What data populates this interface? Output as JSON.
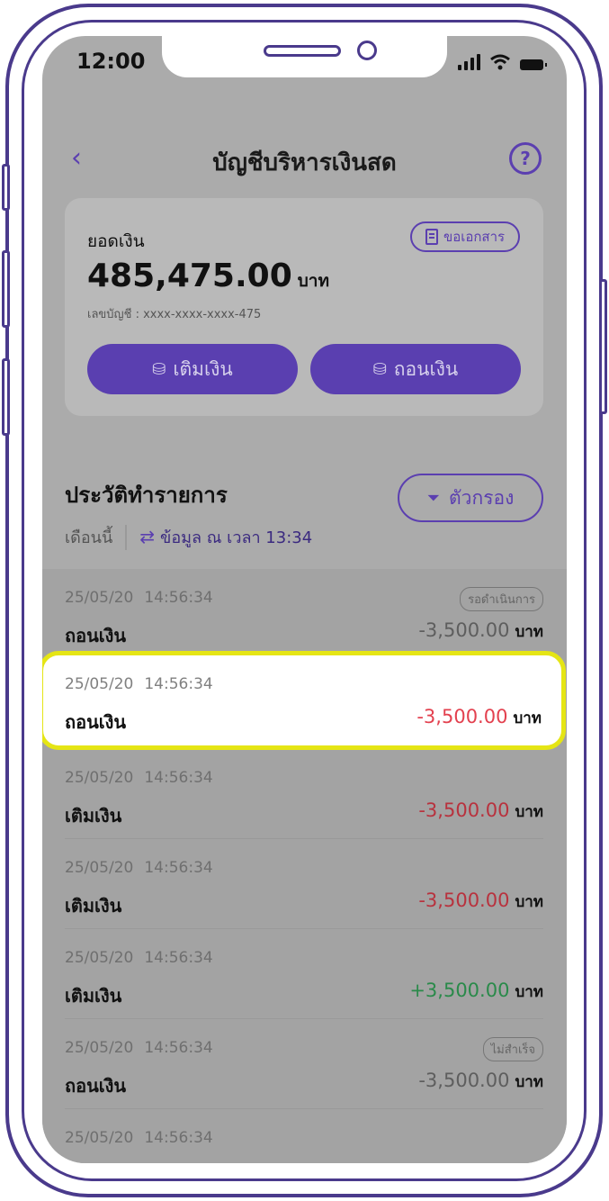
{
  "status_bar": {
    "time": "12:00"
  },
  "header": {
    "back_icon": "‹",
    "title": "บัญชีบริหารเงินสด",
    "help_icon": "?"
  },
  "balance_card": {
    "label": "ยอดเงิน",
    "doc_button": "ขอเอกสาร",
    "amount": "485,475.00",
    "unit": "บาท",
    "account": "เลขบัญชี : xxxx-xxxx-xxxx-475",
    "deposit_button": "เติมเงิน",
    "withdraw_button": "ถอนเงิน"
  },
  "history": {
    "title": "ประวัติทำรายการ",
    "filter_button": "ตัวกรอง",
    "period": "เดือนนี้",
    "sync": "ข้อมูล ณ เวลา 13:34"
  },
  "transactions": [
    {
      "date": "25/05/20",
      "time": "14:56:34",
      "type": "ถอนเงิน",
      "amount": "-3,500.00",
      "unit": "บาท",
      "badge": "รอดำเนินการ",
      "color": "gray"
    },
    {
      "date": "25/05/20",
      "time": "14:56:34",
      "type": "ถอนเงิน",
      "amount": "-3,500.00",
      "unit": "บาท",
      "badge": "",
      "color": "red",
      "highlighted": true
    },
    {
      "date": "25/05/20",
      "time": "14:56:34",
      "type": "เติมเงิน",
      "amount": "-3,500.00",
      "unit": "บาท",
      "badge": "",
      "color": "red"
    },
    {
      "date": "25/05/20",
      "time": "14:56:34",
      "type": "เติมเงิน",
      "amount": "-3,500.00",
      "unit": "บาท",
      "badge": "",
      "color": "red"
    },
    {
      "date": "25/05/20",
      "time": "14:56:34",
      "type": "เติมเงิน",
      "amount": "+3,500.00",
      "unit": "บาท",
      "badge": "",
      "color": "green"
    },
    {
      "date": "25/05/20",
      "time": "14:56:34",
      "type": "ถอนเงิน",
      "amount": "-3,500.00",
      "unit": "บาท",
      "badge": "ไม่สำเร็จ",
      "color": "gray"
    },
    {
      "date": "25/05/20",
      "time": "14:56:34",
      "type": "",
      "amount": "",
      "unit": "",
      "badge": "",
      "color": "green"
    }
  ],
  "colors": {
    "accent": "#5a3fb0",
    "highlight_border": "#e5e515",
    "negative": "#e3414f",
    "positive": "#2a8a4a"
  }
}
